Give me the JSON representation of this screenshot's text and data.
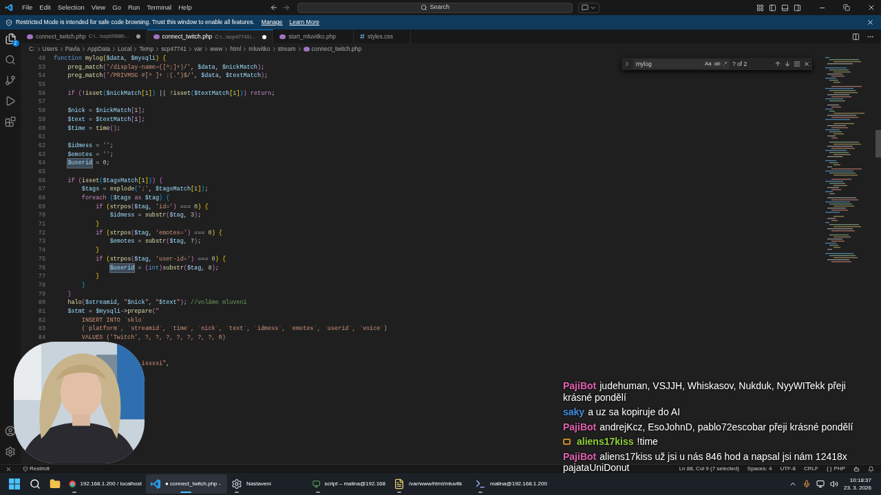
{
  "title_bar": {
    "menu": [
      "File",
      "Edit",
      "Selection",
      "View",
      "Go",
      "Run",
      "Terminal",
      "Help"
    ],
    "search_placeholder": "Search"
  },
  "banner": {
    "message": "Restricted Mode is intended for safe code browsing. Trust this window to enable all features.",
    "links": [
      "Manage",
      "Learn More"
    ]
  },
  "explorer_badge": "2",
  "tabs": [
    {
      "label": "connect_twitch.php",
      "path": "C:\\...\\scp09586\\...",
      "kind": "php",
      "dirty": true,
      "selected": false
    },
    {
      "label": "connect_twitch.php",
      "path": "C:\\...\\scp47741\\...",
      "kind": "php",
      "dirty": true,
      "selected": true
    },
    {
      "label": "start_mluvitko.php",
      "kind": "php",
      "dirty": false,
      "selected": false
    },
    {
      "label": "styles.css",
      "kind": "css",
      "dirty": false,
      "selected": false
    }
  ],
  "breadcrumbs": [
    "C:",
    "Users",
    "Pavla",
    "AppData",
    "Local",
    "Temp",
    "scp47741",
    "var",
    "www",
    "html",
    "mluvitko",
    "stream",
    "connect_twitch.php"
  ],
  "find": {
    "value": "mylog",
    "options": [
      "Aa",
      "ab",
      ".*"
    ],
    "result": "? of 2"
  },
  "editor": {
    "lines": [
      {
        "num": "48",
        "tokens": [
          {
            "kind": "kw",
            "text": "function"
          },
          {
            "kind": "fn",
            "text": " mylog"
          },
          {
            "kind": "b1",
            "text": "("
          },
          {
            "kind": "var",
            "text": "$data"
          },
          {
            "kind": "op",
            "text": ", "
          },
          {
            "kind": "var",
            "text": "$mysqli"
          },
          {
            "kind": "b1",
            "text": ")"
          },
          {
            "kind": "b1",
            "text": " {"
          }
        ]
      },
      {
        "num": "53",
        "tokens": [
          {
            "kind": "fn",
            "text": "    preg_match"
          },
          {
            "kind": "b2",
            "text": "("
          },
          {
            "kind": "str",
            "text": "'/display-name=([^;]+)/'"
          },
          {
            "kind": "op",
            "text": ", "
          },
          {
            "kind": "var",
            "text": "$data"
          },
          {
            "kind": "op",
            "text": ", "
          },
          {
            "kind": "var",
            "text": "$nickMatch"
          },
          {
            "kind": "b2",
            "text": ")"
          },
          {
            "kind": "op",
            "text": ";"
          }
        ]
      },
      {
        "num": "54",
        "tokens": [
          {
            "kind": "fn",
            "text": "    preg_match"
          },
          {
            "kind": "b2",
            "text": "("
          },
          {
            "kind": "str",
            "text": "'/PRIVMSG #[^ ]+ :(.*)$/'"
          },
          {
            "kind": "op",
            "text": ", "
          },
          {
            "kind": "var",
            "text": "$data"
          },
          {
            "kind": "op",
            "text": ", "
          },
          {
            "kind": "var",
            "text": "$textMatch"
          },
          {
            "kind": "b2",
            "text": ")"
          },
          {
            "kind": "op",
            "text": ";"
          }
        ]
      },
      {
        "num": "55"
      },
      {
        "num": "56",
        "tokens": [
          {
            "kind": "ctrl",
            "text": "    if"
          },
          {
            "kind": "b2",
            "text": " ("
          },
          {
            "kind": "op",
            "text": "!"
          },
          {
            "kind": "fn",
            "text": "isset"
          },
          {
            "kind": "b3",
            "text": "("
          },
          {
            "kind": "var",
            "text": "$nickMatch"
          },
          {
            "kind": "b1",
            "text": "["
          },
          {
            "kind": "num",
            "text": "1"
          },
          {
            "kind": "b1",
            "text": "]"
          },
          {
            "kind": "b3",
            "text": ")"
          },
          {
            "kind": "op",
            "text": " || !"
          },
          {
            "kind": "fn",
            "text": "isset"
          },
          {
            "kind": "b3",
            "text": "("
          },
          {
            "kind": "var",
            "text": "$textMatch"
          },
          {
            "kind": "b1",
            "text": "["
          },
          {
            "kind": "num",
            "text": "1"
          },
          {
            "kind": "b1",
            "text": "]"
          },
          {
            "kind": "b3",
            "text": ")"
          },
          {
            "kind": "b2",
            "text": ")"
          },
          {
            "kind": "ctrl",
            "text": " return"
          },
          {
            "kind": "op",
            "text": ";"
          }
        ]
      },
      {
        "num": "57"
      },
      {
        "num": "58",
        "tokens": [
          {
            "kind": "var",
            "text": "    $nick"
          },
          {
            "kind": "op",
            "text": " = "
          },
          {
            "kind": "var",
            "text": "$nickMatch"
          },
          {
            "kind": "b2",
            "text": "["
          },
          {
            "kind": "num",
            "text": "1"
          },
          {
            "kind": "b2",
            "text": "]"
          },
          {
            "kind": "op",
            "text": ";"
          }
        ]
      },
      {
        "num": "59",
        "tokens": [
          {
            "kind": "var",
            "text": "    $text"
          },
          {
            "kind": "op",
            "text": " = "
          },
          {
            "kind": "var",
            "text": "$textMatch"
          },
          {
            "kind": "b2",
            "text": "["
          },
          {
            "kind": "num",
            "text": "1"
          },
          {
            "kind": "b2",
            "text": "]"
          },
          {
            "kind": "op",
            "text": ";"
          }
        ]
      },
      {
        "num": "60",
        "tokens": [
          {
            "kind": "var",
            "text": "    $time"
          },
          {
            "kind": "op",
            "text": " = "
          },
          {
            "kind": "fn",
            "text": "time"
          },
          {
            "kind": "b2",
            "text": "()"
          },
          {
            "kind": "op",
            "text": ";"
          }
        ]
      },
      {
        "num": "61"
      },
      {
        "num": "62",
        "tokens": [
          {
            "kind": "var",
            "text": "    $idmess"
          },
          {
            "kind": "op",
            "text": " = "
          },
          {
            "kind": "str",
            "text": "''"
          },
          {
            "kind": "op",
            "text": ";"
          }
        ]
      },
      {
        "num": "63",
        "tokens": [
          {
            "kind": "var",
            "text": "    $emotes"
          },
          {
            "kind": "op",
            "text": " = "
          },
          {
            "kind": "str",
            "text": "''"
          },
          {
            "kind": "op",
            "text": ";"
          }
        ]
      },
      {
        "num": "64",
        "tokens": [
          {
            "kind": "match",
            "text": "    $userid"
          },
          {
            "kind": "op",
            "text": " = "
          },
          {
            "kind": "num",
            "text": "0"
          },
          {
            "kind": "op",
            "text": ";"
          }
        ]
      },
      {
        "num": "65"
      },
      {
        "num": "66",
        "tokens": [
          {
            "kind": "ctrl",
            "text": "    if"
          },
          {
            "kind": "b2",
            "text": " ("
          },
          {
            "kind": "fn",
            "text": "isset"
          },
          {
            "kind": "b3",
            "text": "("
          },
          {
            "kind": "var",
            "text": "$tagsMatch"
          },
          {
            "kind": "b1",
            "text": "["
          },
          {
            "kind": "num",
            "text": "1"
          },
          {
            "kind": "b1",
            "text": "]"
          },
          {
            "kind": "b3",
            "text": ")"
          },
          {
            "kind": "b2",
            "text": ")"
          },
          {
            "kind": "b2",
            "text": " {"
          }
        ]
      },
      {
        "num": "67",
        "tokens": [
          {
            "kind": "var",
            "text": "        $tags"
          },
          {
            "kind": "op",
            "text": " = "
          },
          {
            "kind": "fn",
            "text": "explode"
          },
          {
            "kind": "b3",
            "text": "("
          },
          {
            "kind": "str",
            "text": "';'"
          },
          {
            "kind": "op",
            "text": ", "
          },
          {
            "kind": "var",
            "text": "$tagsMatch"
          },
          {
            "kind": "b1",
            "text": "["
          },
          {
            "kind": "num",
            "text": "1"
          },
          {
            "kind": "b1",
            "text": "]"
          },
          {
            "kind": "b3",
            "text": ")"
          },
          {
            "kind": "op",
            "text": ";"
          }
        ]
      },
      {
        "num": "68",
        "tokens": [
          {
            "kind": "ctrl",
            "text": "        foreach"
          },
          {
            "kind": "b3",
            "text": " ("
          },
          {
            "kind": "var",
            "text": "$tags"
          },
          {
            "kind": "ctrl",
            "text": " as"
          },
          {
            "kind": "var",
            "text": " $tag"
          },
          {
            "kind": "b3",
            "text": ")"
          },
          {
            "kind": "b3",
            "text": " {"
          }
        ]
      },
      {
        "num": "69",
        "tokens": [
          {
            "kind": "ctrl",
            "text": "            if"
          },
          {
            "kind": "b1",
            "text": " ("
          },
          {
            "kind": "fn",
            "text": "strpos"
          },
          {
            "kind": "b2",
            "text": "("
          },
          {
            "kind": "var",
            "text": "$tag"
          },
          {
            "kind": "op",
            "text": ", "
          },
          {
            "kind": "str",
            "text": "'id='"
          },
          {
            "kind": "b2",
            "text": ")"
          },
          {
            "kind": "op",
            "text": " === "
          },
          {
            "kind": "num",
            "text": "0"
          },
          {
            "kind": "b1",
            "text": ")"
          },
          {
            "kind": "b1",
            "text": " {"
          }
        ]
      },
      {
        "num": "70",
        "tokens": [
          {
            "kind": "var",
            "text": "                $idmess"
          },
          {
            "kind": "op",
            "text": " = "
          },
          {
            "kind": "fn",
            "text": "substr"
          },
          {
            "kind": "b2",
            "text": "("
          },
          {
            "kind": "var",
            "text": "$tag"
          },
          {
            "kind": "op",
            "text": ", "
          },
          {
            "kind": "num",
            "text": "3"
          },
          {
            "kind": "b2",
            "text": ")"
          },
          {
            "kind": "op",
            "text": ";"
          }
        ]
      },
      {
        "num": "71",
        "tokens": [
          {
            "kind": "b1",
            "text": "            }"
          }
        ]
      },
      {
        "num": "72",
        "tokens": [
          {
            "kind": "ctrl",
            "text": "            if"
          },
          {
            "kind": "b1",
            "text": " ("
          },
          {
            "kind": "fn",
            "text": "strpos"
          },
          {
            "kind": "b2",
            "text": "("
          },
          {
            "kind": "var",
            "text": "$tag"
          },
          {
            "kind": "op",
            "text": ", "
          },
          {
            "kind": "str",
            "text": "'emotes='"
          },
          {
            "kind": "b2",
            "text": ")"
          },
          {
            "kind": "op",
            "text": " === "
          },
          {
            "kind": "num",
            "text": "0"
          },
          {
            "kind": "b1",
            "text": ")"
          },
          {
            "kind": "b1",
            "text": " {"
          }
        ]
      },
      {
        "num": "73",
        "tokens": [
          {
            "kind": "var",
            "text": "                $emotes"
          },
          {
            "kind": "op",
            "text": " = "
          },
          {
            "kind": "fn",
            "text": "substr"
          },
          {
            "kind": "b2",
            "text": "("
          },
          {
            "kind": "var",
            "text": "$tag"
          },
          {
            "kind": "op",
            "text": ", "
          },
          {
            "kind": "num",
            "text": "7"
          },
          {
            "kind": "b2",
            "text": ")"
          },
          {
            "kind": "op",
            "text": ";"
          }
        ]
      },
      {
        "num": "74",
        "tokens": [
          {
            "kind": "b1",
            "text": "            }"
          }
        ]
      },
      {
        "num": "75",
        "tokens": [
          {
            "kind": "ctrl",
            "text": "            if"
          },
          {
            "kind": "b1",
            "text": " ("
          },
          {
            "kind": "fn",
            "text": "strpos"
          },
          {
            "kind": "b2",
            "text": "("
          },
          {
            "kind": "var",
            "text": "$tag"
          },
          {
            "kind": "op",
            "text": ", "
          },
          {
            "kind": "str",
            "text": "'user-id='"
          },
          {
            "kind": "b2",
            "text": ")"
          },
          {
            "kind": "op",
            "text": " === "
          },
          {
            "kind": "num",
            "text": "0"
          },
          {
            "kind": "b1",
            "text": ")"
          },
          {
            "kind": "b1",
            "text": " {"
          }
        ]
      },
      {
        "num": "76",
        "tokens": [
          {
            "kind": "match",
            "text": "                $userid"
          },
          {
            "kind": "op",
            "text": " = "
          },
          {
            "kind": "b2",
            "text": "("
          },
          {
            "kind": "kw",
            "text": "int"
          },
          {
            "kind": "b2",
            "text": ")"
          },
          {
            "kind": "fn",
            "text": "substr"
          },
          {
            "kind": "b2",
            "text": "("
          },
          {
            "kind": "var",
            "text": "$tag"
          },
          {
            "kind": "op",
            "text": ", "
          },
          {
            "kind": "num",
            "text": "8"
          },
          {
            "kind": "b2",
            "text": ")"
          },
          {
            "kind": "op",
            "text": ";"
          }
        ]
      },
      {
        "num": "77",
        "tokens": [
          {
            "kind": "b1",
            "text": "            }"
          }
        ]
      },
      {
        "num": "78",
        "tokens": [
          {
            "kind": "b3",
            "text": "        }"
          }
        ]
      },
      {
        "num": "79",
        "tokens": [
          {
            "kind": "b2",
            "text": "    }"
          }
        ]
      },
      {
        "num": "80",
        "tokens": [
          {
            "kind": "fn",
            "text": "    halo"
          },
          {
            "kind": "b2",
            "text": "("
          },
          {
            "kind": "var",
            "text": "$streamid"
          },
          {
            "kind": "op",
            "text": ", "
          },
          {
            "kind": "str",
            "text": "\""
          },
          {
            "kind": "var",
            "text": "$nick"
          },
          {
            "kind": "str",
            "text": "\""
          },
          {
            "kind": "op",
            "text": ", "
          },
          {
            "kind": "str",
            "text": "\""
          },
          {
            "kind": "var",
            "text": "$text"
          },
          {
            "kind": "str",
            "text": "\""
          },
          {
            "kind": "b2",
            "text": ")"
          },
          {
            "kind": "op",
            "text": "; "
          },
          {
            "kind": "cmt",
            "text": "//voláme mluvení"
          }
        ]
      },
      {
        "num": "81",
        "tokens": [
          {
            "kind": "var",
            "text": "    $stmt"
          },
          {
            "kind": "op",
            "text": " = "
          },
          {
            "kind": "var",
            "text": "$mysqli"
          },
          {
            "kind": "op",
            "text": "->"
          },
          {
            "kind": "fn",
            "text": "prepare"
          },
          {
            "kind": "b2",
            "text": "("
          },
          {
            "kind": "str",
            "text": "\""
          }
        ]
      },
      {
        "num": "82",
        "tokens": [
          {
            "kind": "str",
            "text": "        INSERT INTO `sklo`"
          }
        ]
      },
      {
        "num": "83",
        "tokens": [
          {
            "kind": "str",
            "text": "        (`platform`, `streamid`, `time`, `nick`, `text`, `idmess`, `emotes`, `userid`, `voice`)"
          }
        ]
      },
      {
        "num": "84",
        "tokens": [
          {
            "kind": "str",
            "text": "        VALUES ('Twitch', ?, ?, ?, ?, ?, ?, ?, 0)"
          }
        ]
      },
      {
        "kind": "partial",
        "tokens": [
          {
            "kind": "str",
            "text": "                         issssi\""
          },
          {
            "kind": "op",
            "text": ","
          }
        ]
      }
    ]
  },
  "chat": [
    {
      "name": "PajiBot",
      "color": "#e05fb1",
      "badge": false,
      "text": "judehuman, VSJJH, Whiskasov, Nukduk, NyyWITekk přeji krásné pondělí"
    },
    {
      "name": "saky",
      "color": "#3d8ee0",
      "badge": false,
      "text": "a uz sa kopiruje do AI"
    },
    {
      "name": "PajiBot",
      "color": "#e05fb1",
      "badge": false,
      "text": "andrejKcz, EsoJohnD, pablo72escobar přeji krásné pondělí"
    },
    {
      "name": "aliens17kiss",
      "color": "#8fcf3a",
      "badge": true,
      "text": "!time"
    },
    {
      "name": "PajiBot",
      "color": "#e05fb1",
      "badge": false,
      "text": "aliens17kiss už jsi u nás 846 hod a napsal jsi nám 12418x",
      "emote": "pajataUniDonut"
    }
  ],
  "status_bar": {
    "left": "Restricti",
    "items": [
      "Ln 88, Col 9 (7 selected)",
      "Spaces: 4",
      "UTF-8",
      "CRLF"
    ],
    "language_icon": "{ }",
    "language": "PHP"
  },
  "taskbar": {
    "apps": [
      {
        "kind": "chrome",
        "label": "192.168.1.200 / localhost",
        "active": false
      },
      {
        "kind": "vscode",
        "label": "● connect_twitch.php -",
        "active": true
      },
      {
        "kind": "settings",
        "label": "Nastavení",
        "active": false
      },
      {
        "kind": "winscp",
        "label": "script – malina@192.168",
        "active": false
      },
      {
        "kind": "notepad",
        "label": "/var/www/html/mluvitk",
        "active": false
      },
      {
        "kind": "putty",
        "label": "malina@192.168.1.200",
        "active": false
      }
    ],
    "time": "10:18:37",
    "date": "23. 3. 2026"
  }
}
